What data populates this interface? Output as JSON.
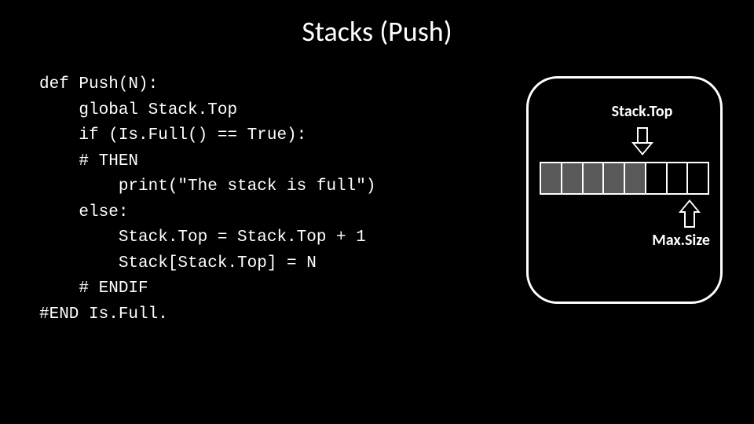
{
  "title": "Stacks (Push)",
  "code": "def Push(N):\n    global Stack.Top\n    if (Is.Full() == True):\n    # THEN\n        print(\"The stack is full\")\n    else:\n        Stack.Top = Stack.Top + 1\n        Stack[Stack.Top] = N\n    # ENDIF\n#END Is.Full.",
  "diagram": {
    "stack_top_label": "Stack.Top",
    "max_size_label": "Max.Size",
    "cells_total": 8,
    "cells_filled": 5
  }
}
